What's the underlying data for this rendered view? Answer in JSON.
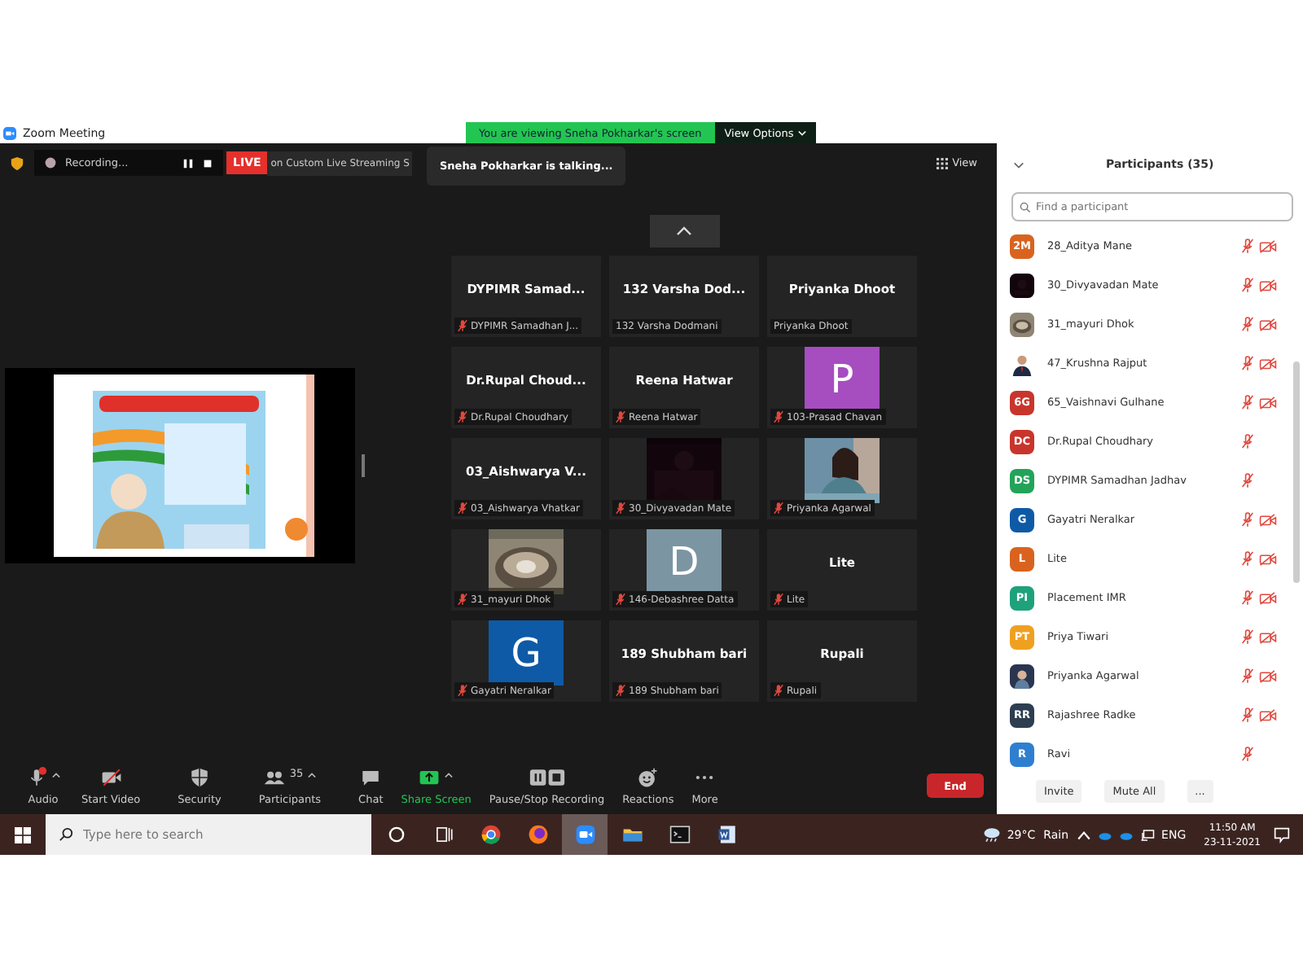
{
  "window": {
    "title": "Zoom Meeting"
  },
  "banner": {
    "text": "You are viewing Sneha Pokharkar's screen",
    "button": "View Options"
  },
  "top_bar": {
    "recording": "Recording...",
    "live": "LIVE",
    "streaming": "on Custom Live Streaming S",
    "talking": "Sneha Pokharkar is talking...",
    "view": "View"
  },
  "tiles": [
    {
      "kind": "name",
      "display_name": "DYPIMR  Samad...",
      "label": "DYPIMR Samadhan J...",
      "mic_muted": true
    },
    {
      "kind": "name",
      "display_name": "132 Varsha Dod...",
      "label": "132 Varsha Dodmani",
      "mic_muted": false
    },
    {
      "kind": "name",
      "display_name": "Priyanka Dhoot",
      "label": "Priyanka Dhoot",
      "mic_muted": false
    },
    {
      "kind": "name",
      "display_name": "Dr.Rupal  Choud...",
      "label": "Dr.Rupal Choudhary",
      "mic_muted": true
    },
    {
      "kind": "name",
      "display_name": "Reena Hatwar",
      "label": "Reena Hatwar",
      "mic_muted": true
    },
    {
      "kind": "letter",
      "letter": "P",
      "color": "#a64dc0",
      "label": "103-Prasad Chavan",
      "mic_muted": true
    },
    {
      "kind": "name",
      "display_name": "03_Aishwarya V...",
      "label": "03_Aishwarya Vhatkar",
      "mic_muted": true
    },
    {
      "kind": "picture",
      "label": "30_Divyavadan Mate",
      "mic_muted": true
    },
    {
      "kind": "picture",
      "label": "Priyanka Agarwal",
      "mic_muted": true
    },
    {
      "kind": "picture",
      "label": "31_mayuri Dhok",
      "mic_muted": true
    },
    {
      "kind": "letter",
      "letter": "D",
      "color": "#7b95a3",
      "label": "146-Debashree Datta",
      "mic_muted": true
    },
    {
      "kind": "name",
      "display_name": "Lite",
      "label": "Lite",
      "mic_muted": true
    },
    {
      "kind": "letter",
      "letter": "G",
      "color": "#0e5aa7",
      "label": "Gayatri Neralkar",
      "mic_muted": true
    },
    {
      "kind": "name",
      "display_name": "189 Shubham bari",
      "label": "189 Shubham bari",
      "mic_muted": true
    },
    {
      "kind": "name",
      "display_name": "Rupali",
      "label": "Rupali",
      "mic_muted": true
    }
  ],
  "panel": {
    "title": "Participants (35)",
    "search_placeholder": "Find a participant",
    "participants": [
      {
        "kind": "initials",
        "initials": "2M",
        "color": "#d9631e",
        "name": "28_Aditya Mane",
        "mic_muted": true,
        "video_off": true
      },
      {
        "kind": "picture",
        "name": "30_Divyavadan Mate",
        "mic_muted": true,
        "video_off": true
      },
      {
        "kind": "picture",
        "name": "31_mayuri Dhok",
        "mic_muted": true,
        "video_off": true
      },
      {
        "kind": "picture",
        "name": "47_Krushna Rajput",
        "mic_muted": true,
        "video_off": true
      },
      {
        "kind": "initials",
        "initials": "6G",
        "color": "#c8352c",
        "name": "65_Vaishnavi Gulhane",
        "mic_muted": true,
        "video_off": true
      },
      {
        "kind": "initials",
        "initials": "DC",
        "color": "#c8352c",
        "name": "Dr.Rupal Choudhary",
        "mic_muted": true,
        "video_off": false
      },
      {
        "kind": "initials",
        "initials": "DS",
        "color": "#23a35a",
        "name": "DYPIMR Samadhan Jadhav",
        "mic_muted": true,
        "video_off": false
      },
      {
        "kind": "initials",
        "initials": "G",
        "color": "#0e5aa7",
        "name": "Gayatri Neralkar",
        "mic_muted": true,
        "video_off": true
      },
      {
        "kind": "initials",
        "initials": "L",
        "color": "#d9631e",
        "name": "Lite",
        "mic_muted": true,
        "video_off": true
      },
      {
        "kind": "initials",
        "initials": "PI",
        "color": "#1ea27c",
        "name": "Placement IMR",
        "mic_muted": true,
        "video_off": true
      },
      {
        "kind": "initials",
        "initials": "PT",
        "color": "#f0a020",
        "name": "Priya Tiwari",
        "mic_muted": true,
        "video_off": true
      },
      {
        "kind": "picture",
        "name": "Priyanka Agarwal",
        "mic_muted": true,
        "video_off": true
      },
      {
        "kind": "initials",
        "initials": "RR",
        "color": "#2d3e50",
        "name": "Rajashree Radke",
        "mic_muted": true,
        "video_off": true
      },
      {
        "kind": "initials",
        "initials": "R",
        "color": "#2f7fd0",
        "name": "Ravi",
        "mic_muted": true,
        "video_off": false
      }
    ],
    "buttons": [
      "Invite",
      "Mute All",
      "..."
    ]
  },
  "toolbar": {
    "items": [
      {
        "kind": "audio",
        "label": "Audio",
        "caret": true,
        "alert": true
      },
      {
        "kind": "video",
        "label": "Start Video",
        "caret": false
      },
      {
        "kind": "security",
        "label": "Security",
        "caret": false
      },
      {
        "kind": "participants",
        "label": "Participants",
        "count": "35",
        "caret": true
      },
      {
        "kind": "chat",
        "label": "Chat",
        "caret": false
      },
      {
        "kind": "share",
        "label": "Share Screen",
        "caret": true
      },
      {
        "kind": "recording",
        "label": "Pause/Stop Recording",
        "caret": false
      },
      {
        "kind": "reactions",
        "label": "Reactions",
        "caret": false
      },
      {
        "kind": "more",
        "label": "More",
        "caret": false
      }
    ],
    "end": "End"
  },
  "taskbar": {
    "search_placeholder": "Type here to search",
    "apps": [
      {
        "kind": "circle",
        "selected": false
      },
      {
        "kind": "taskview",
        "selected": false
      },
      {
        "kind": "chrome",
        "selected": false
      },
      {
        "kind": "firefox",
        "selected": false
      },
      {
        "kind": "zoom",
        "selected": true
      },
      {
        "kind": "folder",
        "selected": false
      },
      {
        "kind": "terminal",
        "selected": false
      },
      {
        "kind": "document",
        "selected": false
      }
    ],
    "temperature": "29°C",
    "weather": "Rain",
    "language": "ENG",
    "time": "11:50 AM",
    "date": "23-11-2021"
  }
}
